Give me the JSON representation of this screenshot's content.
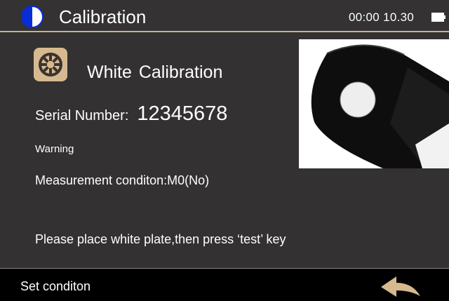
{
  "header": {
    "title": "Calibration",
    "clock": "00:00 10.30",
    "app_icon": "half-circle-icon",
    "battery_icon": "battery-icon"
  },
  "main": {
    "calibration_icon": "calibration-gear-icon",
    "heading": "White Calibration",
    "serial_label": "Serial Number:",
    "serial_value": "12345678",
    "warning": "Warning",
    "condition": "Measurement conditon:M0(No)",
    "instruction": "Please place white plate,then press ‘test’ key",
    "image": "white-calibration-plate-photo"
  },
  "footer": {
    "set_condition": "Set conditon",
    "back_icon": "back-arrow-icon"
  },
  "colors": {
    "header_bg": "#343232",
    "body_bg": "#333131",
    "footer_bg": "#000000",
    "accent_tan": "#d6b98f",
    "icon_blue": "#0a2cd6"
  }
}
